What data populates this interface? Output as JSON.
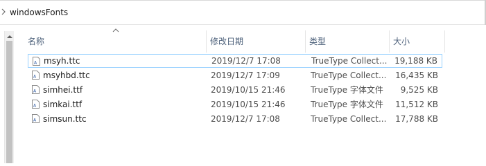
{
  "breadcrumb": {
    "folder": "windowsFonts"
  },
  "columns": [
    {
      "label": "名称"
    },
    {
      "label": "修改日期"
    },
    {
      "label": "类型"
    },
    {
      "label": "大小"
    }
  ],
  "files": [
    {
      "name": "msyh.ttc",
      "date": "2019/12/7 17:08",
      "type": "TrueType Collect...",
      "size": "19,188 KB",
      "selected": true
    },
    {
      "name": "msyhbd.ttc",
      "date": "2019/12/7 17:09",
      "type": "TrueType Collect...",
      "size": "16,435 KB"
    },
    {
      "name": "simhei.ttf",
      "date": "2019/10/15 21:46",
      "type": "TrueType 字体文件",
      "size": "9,525 KB"
    },
    {
      "name": "simkai.ttf",
      "date": "2019/10/15 21:46",
      "type": "TrueType 字体文件",
      "size": "11,512 KB"
    },
    {
      "name": "simsun.ttc",
      "date": "2019/12/7 17:08",
      "type": "TrueType Collect...",
      "size": "17,788 KB"
    }
  ],
  "icons": {
    "breadcrumb_separator": "chevron-right-icon",
    "sort": "sort-ascending-icon",
    "file": "font-file-icon"
  },
  "colors": {
    "selection_border": "#99d1ff",
    "header_text": "#4c607a"
  }
}
